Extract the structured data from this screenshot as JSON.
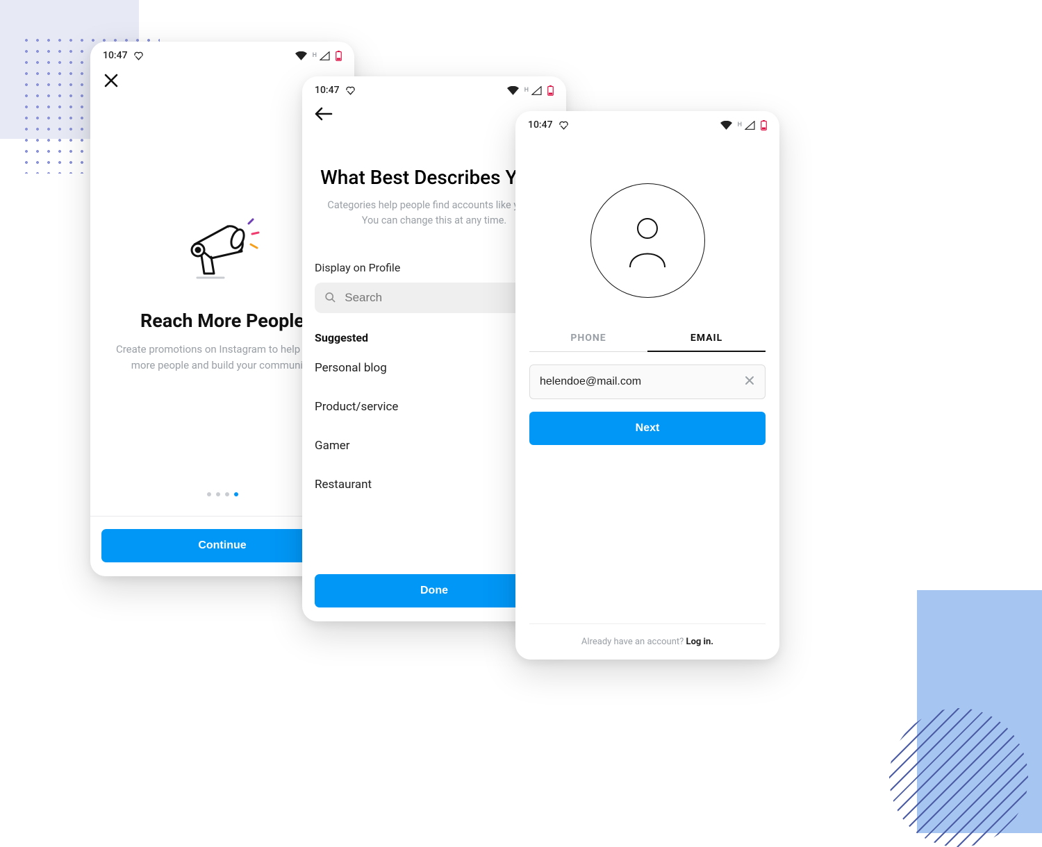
{
  "status": {
    "time": "10:47",
    "network_label": "H"
  },
  "phone1": {
    "title": "Reach More People",
    "subtitle": "Create promotions on Instagram to help reach more people and build your community.",
    "cta": "Continue",
    "pager_index": 3,
    "pager_count": 4
  },
  "phone2": {
    "title": "What Best Describes You?",
    "subtitle": "Categories help people find accounts like yours. You can change this at any time.",
    "display_label": "Display on Profile",
    "search_placeholder": "Search",
    "suggested_label": "Suggested",
    "categories": [
      "Personal blog",
      "Product/service",
      "Gamer",
      "Restaurant"
    ],
    "cta": "Done"
  },
  "phone3": {
    "tabs": {
      "phone": "PHONE",
      "email": "EMAIL",
      "active": "email"
    },
    "email_value": "helendoe@mail.com",
    "cta": "Next",
    "footer_prefix": "Already have an account? ",
    "footer_link": "Log in."
  }
}
